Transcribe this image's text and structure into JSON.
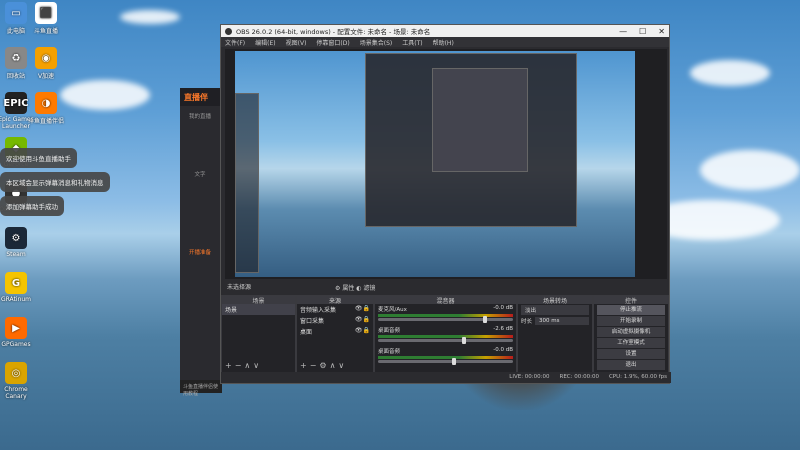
{
  "desktop": {
    "icons": [
      {
        "label": "此电脑",
        "glyph": "▭",
        "color": "#4a90d9"
      },
      {
        "label": "回收站",
        "glyph": "♻",
        "color": "#888"
      },
      {
        "label": "Epic Games Launcher",
        "glyph": "EPIC",
        "color": "#222"
      },
      {
        "label": "GeForce",
        "glyph": "◆",
        "color": "#76b900"
      },
      {
        "label": "OBS Studio",
        "glyph": "●",
        "color": "#333"
      },
      {
        "label": "Steam",
        "glyph": "⚙",
        "color": "#1b2838"
      },
      {
        "label": "GRAtinum",
        "glyph": "G",
        "color": "#f5c400"
      },
      {
        "label": "GPGames",
        "glyph": "▶",
        "color": "#ff6a00"
      },
      {
        "label": "Chrome Canary",
        "glyph": "◎",
        "color": "#d9a400"
      }
    ],
    "icons_col2": [
      {
        "label": "斗鱼直播",
        "glyph": "⬛",
        "color": "#fff"
      },
      {
        "label": "V加速",
        "glyph": "◉",
        "color": "#f4a000"
      },
      {
        "label": "斗鱼直播伴侣",
        "glyph": "◑",
        "color": "#ff7a00"
      }
    ],
    "toasts": [
      "欢迎使用斗鱼直播助手",
      "本区域会显示弹幕消息和礼物消息",
      "添加弹幕助手成功"
    ]
  },
  "live_panel": {
    "logo": "直播伴",
    "items": [
      "我的直播",
      "",
      "文字",
      "开播准备"
    ],
    "active": "开播准备",
    "footer": "斗鱼直播伴侣使用教程"
  },
  "obs": {
    "title": "OBS 26.0.2 (64-bit, windows) - 配置文件: 未命名 - 场景: 未命名",
    "menu": [
      "文件(F)",
      "编辑(E)",
      "视图(V)",
      "停靠窗口(D)",
      "场景集合(S)",
      "工具(T)",
      "帮助(H)"
    ],
    "no_source": "未选择源",
    "prop_btn": "属性",
    "filter_btn": "滤镜",
    "docks": {
      "scenes": {
        "title": "场景",
        "items": [
          "场景"
        ]
      },
      "sources": {
        "title": "来源",
        "items": [
          "音频输入采集",
          "窗口采集",
          "桌面"
        ]
      },
      "mixer": {
        "title": "混音器",
        "channels": [
          {
            "name": "麦克风/Aux",
            "db": "-0.0 dB",
            "level": 0.78
          },
          {
            "name": "桌面音频",
            "db": "-2.6 dB",
            "level": 0.62
          },
          {
            "name": "桌面音频",
            "db": "-0.0 dB",
            "level": 0.55
          }
        ]
      },
      "transitions": {
        "title": "场景转场",
        "mode": "淡出",
        "duration_label": "时长",
        "duration": "300 ms"
      },
      "controls": {
        "title": "控件",
        "buttons": [
          "停止推流",
          "开始录制",
          "启动虚拟摄像机",
          "工作室模式",
          "设置",
          "退出"
        ]
      }
    },
    "status": [
      "LIVE: 00:00:00",
      "REC: 00:00:00",
      "CPU: 1.9%, 60.00 fps"
    ]
  }
}
